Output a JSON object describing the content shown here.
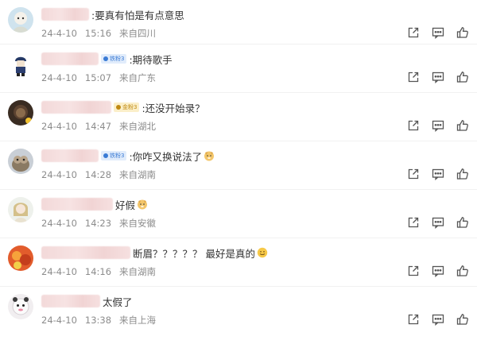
{
  "comments": [
    {
      "text": ":要真有怕是有点意思",
      "date": "24-4-10",
      "time": "15:16",
      "location": "来自四川",
      "badge": "",
      "emoji": ""
    },
    {
      "text": ":期待歌手",
      "date": "24-4-10",
      "time": "15:07",
      "location": "来自广东",
      "badge": "铁粉3",
      "emoji": ""
    },
    {
      "text": ":还没开始录？",
      "date": "24-4-10",
      "time": "14:47",
      "location": "来自湖北",
      "badge": "金粉3",
      "emoji": ""
    },
    {
      "text": ":你咋又换说法了",
      "date": "24-4-10",
      "time": "14:28",
      "location": "来自湖南",
      "badge": "铁粉3",
      "emoji": "doge-icon"
    },
    {
      "text": "好假",
      "date": "24-4-10",
      "time": "14:23",
      "location": "来自安徽",
      "badge": "",
      "emoji": "doge-icon"
    },
    {
      "text": "断眉？？？？？ 最好是真的",
      "date": "24-4-10",
      "time": "14:16",
      "location": "来自湖南",
      "badge": "",
      "emoji": "smile-icon"
    },
    {
      "text": "太假了",
      "date": "24-4-10",
      "time": "13:38",
      "location": "来自上海",
      "badge": "",
      "emoji": ""
    }
  ],
  "actions": [
    "share-icon",
    "comment-icon",
    "like-icon"
  ],
  "colors": {
    "meta_text": "#8c8c8c",
    "icon": "#555555",
    "badge_blue": "#3a7bd5",
    "badge_gold": "#c08a12"
  }
}
